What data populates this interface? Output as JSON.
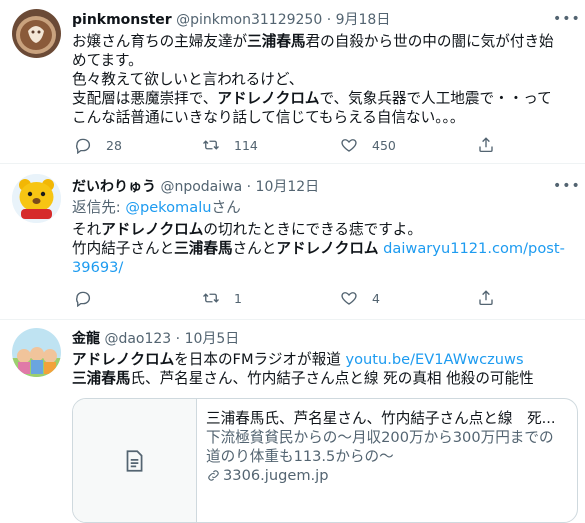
{
  "tweets": [
    {
      "name": "pinkmonster",
      "handle": "@pinkmon31129250",
      "sep": "·",
      "date": "9月18日",
      "lines": [
        [
          {
            "t": "お嬢さん育ちの主婦友達が"
          },
          {
            "t": "三浦春馬",
            "b": true
          },
          {
            "t": "君の自殺から世の中の闇に気が付き始"
          }
        ],
        [
          {
            "t": "めてます。"
          }
        ],
        [
          {
            "t": "色々教えて欲しいと言われるけど、"
          }
        ],
        [
          {
            "t": "支配層は悪魔崇拝で、"
          },
          {
            "t": "アドレノクロム",
            "b": true
          },
          {
            "t": "で、気象兵器で人工地震で・・って"
          }
        ],
        [
          {
            "t": "こんな話普通にいきなり話して信じてもらえる自信ない。。。"
          }
        ]
      ],
      "replies": "28",
      "retweets": "114",
      "likes": "450"
    },
    {
      "name": "だいわりゅう",
      "handle": "@npodaiwa",
      "sep": "·",
      "date": "10月12日",
      "reply_to_label": "返信先: ",
      "reply_to_handle": "@pekomalu",
      "reply_to_suffix": "さん",
      "lines": [
        [
          {
            "t": "それ"
          },
          {
            "t": "アドレノクロム",
            "b": true
          },
          {
            "t": "の切れたときにできる痣ですよ。"
          }
        ],
        [
          {
            "t": "竹内結子さんと"
          },
          {
            "t": "三浦春馬",
            "b": true
          },
          {
            "t": "さんと"
          },
          {
            "t": "アドレノクロム",
            "b": true
          },
          {
            "t": " "
          },
          {
            "t": "daiwaryu1121.com/post-",
            "l": true
          }
        ],
        [
          {
            "t": "39693/",
            "l": true
          }
        ]
      ],
      "replies": "",
      "retweets": "1",
      "likes": "4"
    },
    {
      "name": "金龍",
      "handle": "@dao123",
      "sep": "·",
      "date": "10月5日",
      "lines": [
        [
          {
            "t": "アドレノクロム",
            "b": true
          },
          {
            "t": "を日本のFMラジオが報道 "
          },
          {
            "t": "youtu.be/EV1AWwczuws",
            "l": true
          }
        ],
        [
          {
            "t": "三浦春馬",
            "b": true
          },
          {
            "t": "氏、芦名星さん、竹内結子さん点と線 死の真相 他殺の可能性"
          }
        ]
      ],
      "card": {
        "title": "三浦春馬氏、芦名星さん、竹内結子さん点と線　死...",
        "desc_1": "下流極貧貧民からの～月収200万から300万円までの",
        "desc_2": "道のり体重も113.5からの～",
        "domain": "3306.jugem.jp"
      }
    }
  ],
  "icons": {
    "more": "more-icon",
    "reply": "reply-icon",
    "retweet": "retweet-icon",
    "like": "heart-icon",
    "share": "share-icon",
    "link": "link-icon",
    "document": "document-icon"
  },
  "colors": {
    "link": "#1d9bf0",
    "muted": "#536471",
    "text": "#0f1419",
    "border": "#cfd9de"
  }
}
